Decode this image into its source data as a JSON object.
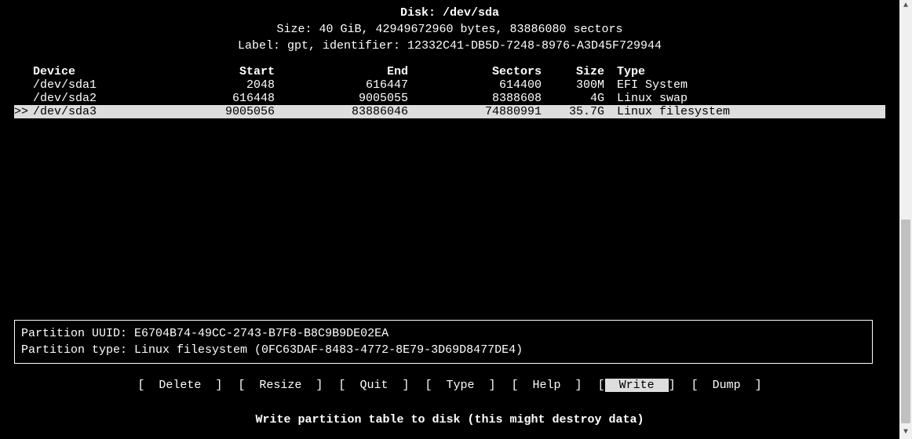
{
  "header": {
    "disk_label": "Disk: /dev/sda",
    "size_line": "Size: 40 GiB, 42949672960 bytes, 83886080 sectors",
    "label_line": "Label: gpt, identifier: 12332C41-DB5D-7248-8976-A3D45F729944"
  },
  "columns": {
    "device": "Device",
    "start": "Start",
    "end": "End",
    "sectors": "Sectors",
    "size": "Size",
    "type": "Type"
  },
  "partitions": [
    {
      "device": "/dev/sda1",
      "start": "2048",
      "end": "616447",
      "sectors": "614400",
      "size": "300M",
      "type": "EFI System",
      "selected": false
    },
    {
      "device": "/dev/sda2",
      "start": "616448",
      "end": "9005055",
      "sectors": "8388608",
      "size": "4G",
      "type": "Linux swap",
      "selected": false
    },
    {
      "device": "/dev/sda3",
      "start": "9005056",
      "end": "83886046",
      "sectors": "74880991",
      "size": "35.7G",
      "type": "Linux filesystem",
      "selected": true
    }
  ],
  "info": {
    "uuid_line": "Partition UUID: E6704B74-49CC-2743-B7F8-B8C9B9DE02EA",
    "type_line": "Partition type: Linux filesystem (0FC63DAF-8483-4772-8E79-3D69D8477DE4)"
  },
  "menu": [
    {
      "label": "Delete",
      "selected": false
    },
    {
      "label": "Resize",
      "selected": false
    },
    {
      "label": "Quit",
      "selected": false
    },
    {
      "label": "Type",
      "selected": false
    },
    {
      "label": "Help",
      "selected": false
    },
    {
      "label": "Write",
      "selected": true
    },
    {
      "label": "Dump",
      "selected": false
    }
  ],
  "status": "Write partition table to disk (this might destroy data)",
  "pointer": ">>"
}
